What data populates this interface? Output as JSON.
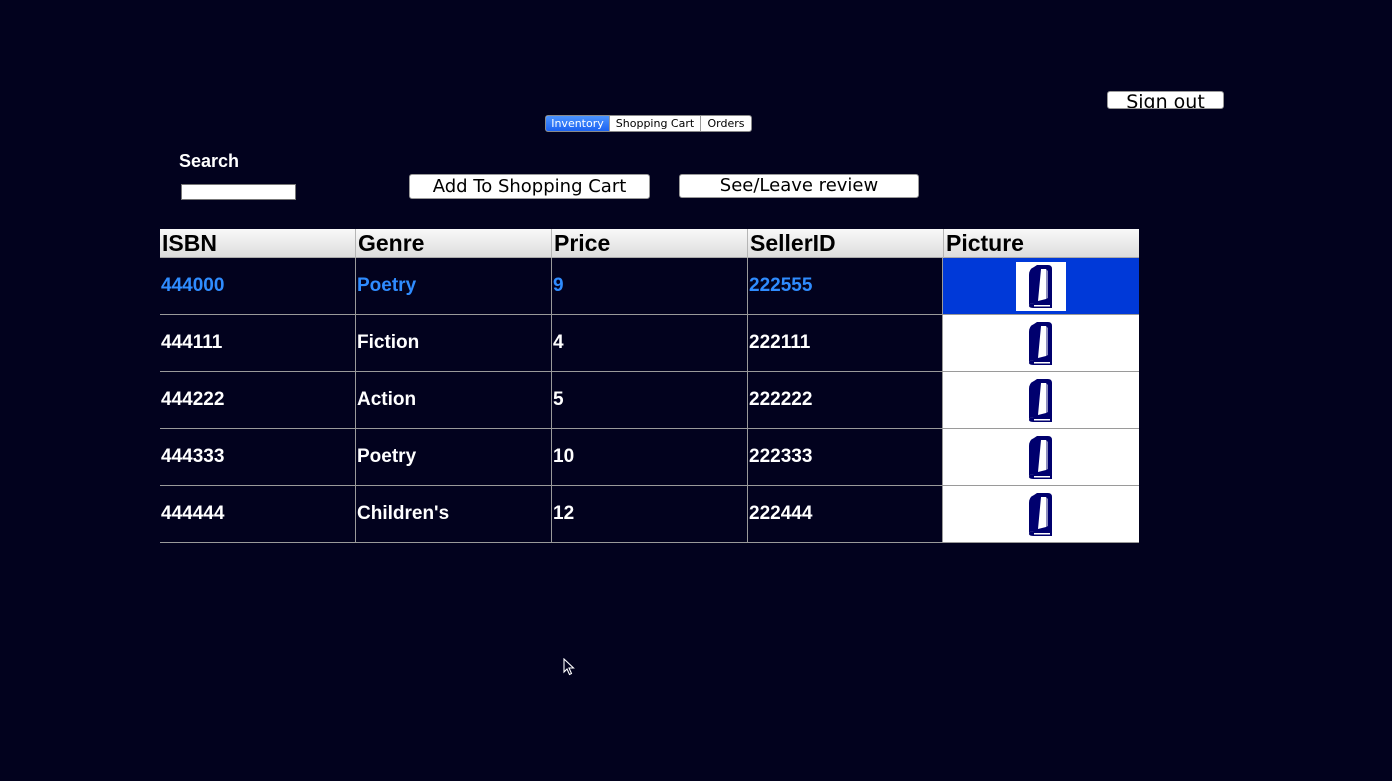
{
  "header": {
    "sign_out_label": "Sign out"
  },
  "tabs": [
    {
      "label": "Inventory",
      "active": true
    },
    {
      "label": "Shopping Cart",
      "active": false
    },
    {
      "label": "Orders",
      "active": false
    }
  ],
  "search": {
    "label": "Search",
    "value": ""
  },
  "actions": {
    "add_to_cart_label": "Add To Shopping Cart",
    "review_label": "See/Leave review"
  },
  "table": {
    "columns": [
      "ISBN",
      "Genre",
      "Price",
      "SellerID",
      "Picture"
    ],
    "rows": [
      {
        "isbn": "444000",
        "genre": "Poetry",
        "price": "9",
        "seller_id": "222555",
        "picture": "book-icon",
        "selected": true
      },
      {
        "isbn": "444111",
        "genre": "Fiction",
        "price": "4",
        "seller_id": "222111",
        "picture": "book-icon",
        "selected": false
      },
      {
        "isbn": "444222",
        "genre": "Action",
        "price": "5",
        "seller_id": "222222",
        "picture": "book-icon",
        "selected": false
      },
      {
        "isbn": "444333",
        "genre": "Poetry",
        "price": "10",
        "seller_id": "222333",
        "picture": "book-icon",
        "selected": false
      },
      {
        "isbn": "444444",
        "genre": "Children's",
        "price": "12",
        "seller_id": "222444",
        "picture": "book-icon",
        "selected": false
      }
    ]
  },
  "colors": {
    "background": "#02021e",
    "selected_text": "#2f8cff",
    "selected_picture_bg": "#0039d8",
    "book_icon": "#00006e"
  }
}
